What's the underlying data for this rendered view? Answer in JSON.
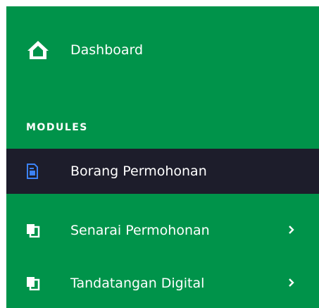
{
  "sidebar": {
    "dashboard": {
      "label": "Dashboard",
      "icon": "home-icon"
    },
    "section_label": "MODULES",
    "items": [
      {
        "label": "Borang Permohonan",
        "icon": "document-icon",
        "active": true
      },
      {
        "label": "Senarai Permohonan",
        "icon": "copy-icon",
        "has_submenu": true
      },
      {
        "label": "Tandatangan Digital",
        "icon": "copy-icon",
        "has_submenu": true
      }
    ]
  },
  "colors": {
    "sidebar_bg": "#00934a",
    "active_bg": "#1d1d2b",
    "active_icon": "#3b82f6",
    "text": "#ffffff"
  }
}
